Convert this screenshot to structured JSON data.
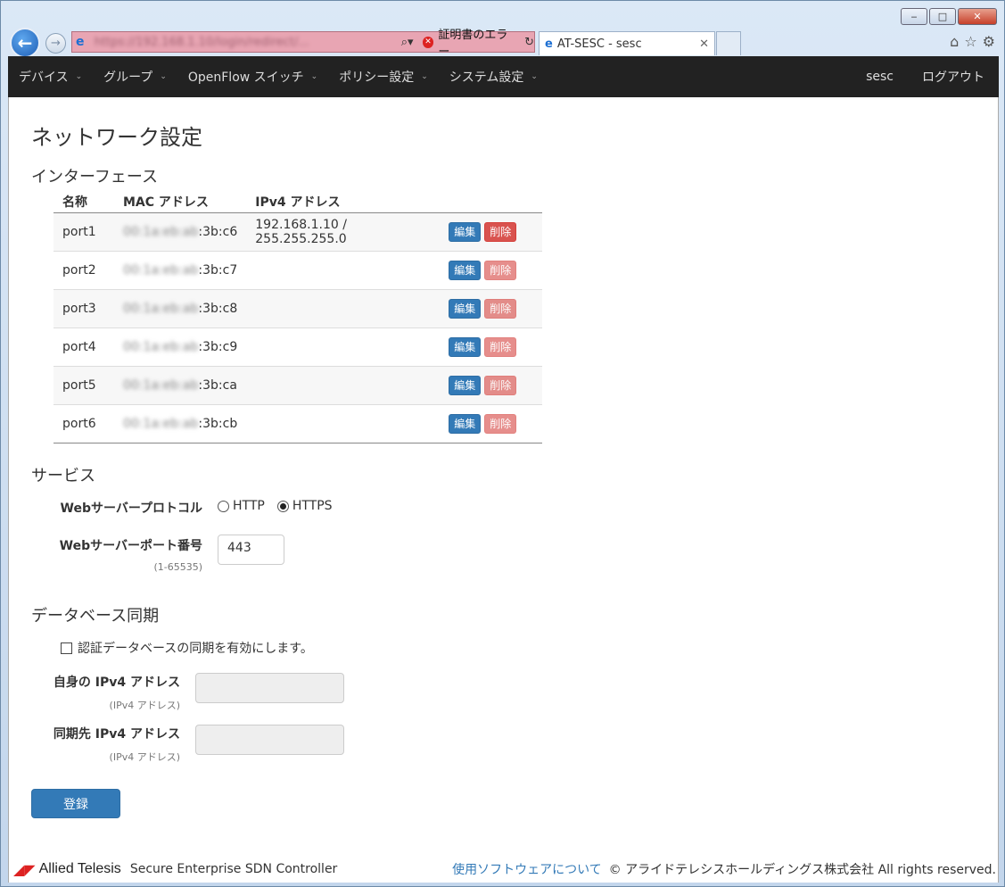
{
  "browser": {
    "address_url": "https://192.168.1.10/login/redirect/...",
    "cert_error": "証明書のエラー",
    "tab_title": "AT-SESC - sesc"
  },
  "nav": {
    "items": [
      {
        "label": "デバイス"
      },
      {
        "label": "グループ"
      },
      {
        "label": "OpenFlow スイッチ"
      },
      {
        "label": "ポリシー設定"
      },
      {
        "label": "システム設定"
      }
    ],
    "user": "sesc",
    "logout": "ログアウト"
  },
  "page": {
    "title": "ネットワーク設定"
  },
  "interfaces": {
    "heading": "インターフェース",
    "columns": [
      "名称",
      "MAC アドレス",
      "IPv4 アドレス"
    ],
    "edit_label": "編集",
    "delete_label": "削除",
    "rows": [
      {
        "name": "port1",
        "mac_hidden": "00:1a:eb:ab",
        "mac_suffix": ":3b:c6",
        "ipv4": "192.168.1.10 / 255.255.255.0",
        "delete_enabled": true
      },
      {
        "name": "port2",
        "mac_hidden": "00:1a:eb:ab",
        "mac_suffix": ":3b:c7",
        "ipv4": "",
        "delete_enabled": false
      },
      {
        "name": "port3",
        "mac_hidden": "00:1a:eb:ab",
        "mac_suffix": ":3b:c8",
        "ipv4": "",
        "delete_enabled": false
      },
      {
        "name": "port4",
        "mac_hidden": "00:1a:eb:ab",
        "mac_suffix": ":3b:c9",
        "ipv4": "",
        "delete_enabled": false
      },
      {
        "name": "port5",
        "mac_hidden": "00:1a:eb:ab",
        "mac_suffix": ":3b:ca",
        "ipv4": "",
        "delete_enabled": false
      },
      {
        "name": "port6",
        "mac_hidden": "00:1a:eb:ab",
        "mac_suffix": ":3b:cb",
        "ipv4": "",
        "delete_enabled": false
      }
    ]
  },
  "service": {
    "heading": "サービス",
    "protocol_label": "Webサーバープロトコル",
    "protocol_options": [
      "HTTP",
      "HTTPS"
    ],
    "protocol_selected": "HTTPS",
    "port_label": "Webサーバーポート番号",
    "port_hint": "(1-65535)",
    "port_value": "443"
  },
  "dbsync": {
    "heading": "データベース同期",
    "enable_label": "認証データベースの同期を有効にします。",
    "enabled": false,
    "self_ip_label": "自身の IPv4 アドレス",
    "self_ip_hint": "(IPv4 アドレス)",
    "peer_ip_label": "同期先 IPv4 アドレス",
    "peer_ip_hint": "(IPv4 アドレス)"
  },
  "submit_label": "登録",
  "footer": {
    "brand": "Allied Telesis",
    "product": "Secure Enterprise SDN Controller",
    "software_link": "使用ソフトウェアについて",
    "copyright": "© アライドテレシスホールディングス株式会社 All rights reserved."
  },
  "colors": {
    "primary": "#337ab7",
    "danger": "#d9534f",
    "navbar": "#222222"
  }
}
